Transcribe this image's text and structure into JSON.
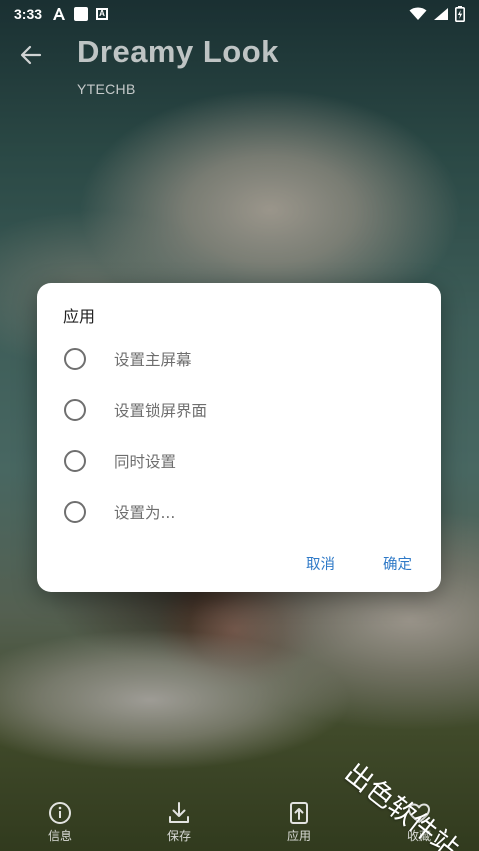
{
  "status_bar": {
    "time": "3:33",
    "icons": [
      "a-font-icon",
      "square-notification-icon",
      "a-box-icon",
      "wifi-icon",
      "signal-icon",
      "battery-charging-icon"
    ]
  },
  "app_bar": {
    "title": "Dreamy Look",
    "subtitle": "YTECHB",
    "back_icon": "arrow-left-icon"
  },
  "dialog": {
    "title": "应用",
    "options": [
      {
        "label": "设置主屏幕",
        "selected": false
      },
      {
        "label": "设置锁屏界面",
        "selected": false
      },
      {
        "label": "同时设置",
        "selected": false
      },
      {
        "label": "设置为...",
        "selected": false
      }
    ],
    "cancel_label": "取消",
    "confirm_label": "确定",
    "accent_color": "#2e79c7"
  },
  "bottom_nav": {
    "items": [
      {
        "label": "信息",
        "icon": "info-icon"
      },
      {
        "label": "保存",
        "icon": "download-icon"
      },
      {
        "label": "应用",
        "icon": "apply-wallpaper-icon"
      },
      {
        "label": "收藏",
        "icon": "heart-icon"
      }
    ]
  },
  "watermark": "出色软件站"
}
